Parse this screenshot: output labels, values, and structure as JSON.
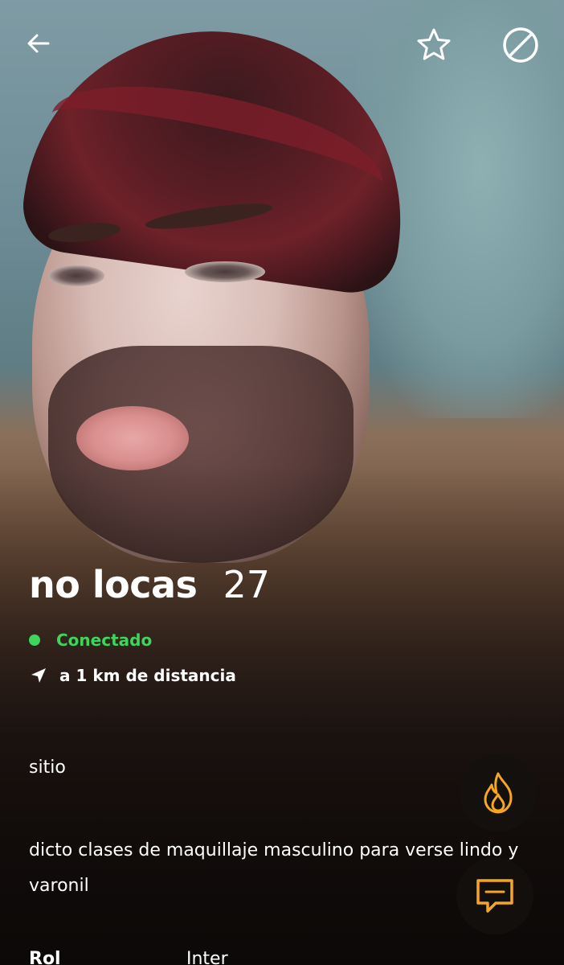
{
  "topbar": {
    "back_icon": "arrow-left-icon",
    "favorite_icon": "star-outline-icon",
    "block_icon": "block-circle-icon"
  },
  "profile": {
    "name": "no locas",
    "age": "27",
    "status": "Conectado",
    "status_color": "#3fd45e",
    "distance": "a 1 km de distancia",
    "headline": "sitio",
    "about": "dicto clases de maquillaje masculino para verse lindo y varonil"
  },
  "actions": {
    "tap_icon": "flame-icon",
    "tap_color": "#f5a623",
    "chat_icon": "chat-bubble-icon",
    "chat_color": "#f5a623"
  },
  "fields": {
    "rol_label": "Rol",
    "inter_label": "Inter"
  }
}
